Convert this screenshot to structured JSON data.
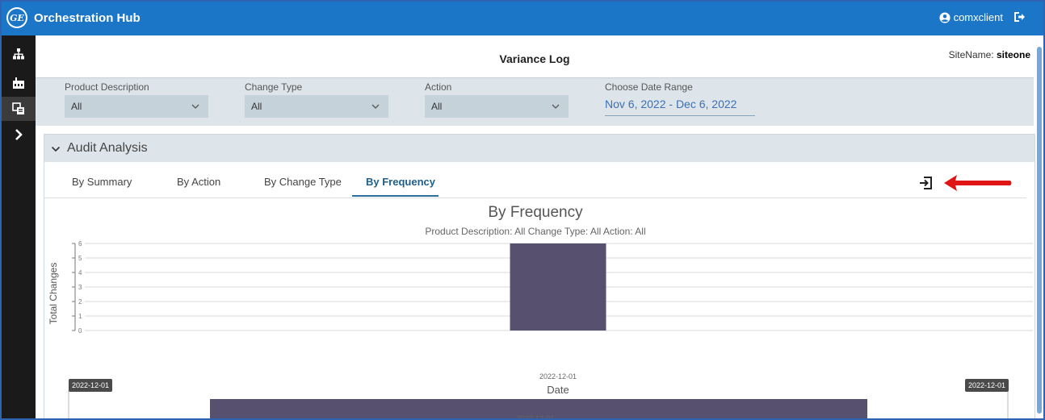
{
  "app": {
    "logo_text": "GE",
    "title": "Orchestration Hub",
    "user": "comxclient"
  },
  "page": {
    "title": "Variance Log",
    "sitename_label": "SiteName:",
    "sitename_value": "siteone"
  },
  "filters": {
    "product": {
      "label": "Product Description",
      "value": "All"
    },
    "change_type": {
      "label": "Change Type",
      "value": "All"
    },
    "action": {
      "label": "Action",
      "value": "All"
    },
    "date": {
      "label": "Choose Date Range",
      "value": "Nov 6, 2022 - Dec 6, 2022"
    }
  },
  "panel": {
    "title": "Audit Analysis",
    "tabs": [
      {
        "label": "By Summary",
        "active": false
      },
      {
        "label": "By Action",
        "active": false
      },
      {
        "label": "By Change Type",
        "active": false
      },
      {
        "label": "By Frequency",
        "active": true
      }
    ]
  },
  "icons": {
    "logo": "ge-logo",
    "user": "user-circle-icon",
    "logout": "logout-icon",
    "rail": [
      "sitemap-icon",
      "factory-icon",
      "clone-icon",
      "chevron-right-icon"
    ],
    "export": "export-icon",
    "collapse": "chevron-down-icon"
  },
  "colors": {
    "topbar": "#1b76c8",
    "bar": "#57506f",
    "accent_tab": "#1e5f8c",
    "date_text": "#3d6fb4",
    "arrow": "#e01515"
  },
  "chart_data": {
    "type": "bar",
    "title": "By Frequency",
    "subtitle": "Product Description: All   Change Type: All   Action: All",
    "categories": [
      "2022-12-01"
    ],
    "values": [
      6
    ],
    "xlabel": "Date",
    "ylabel": "Total Changes",
    "ylim": [
      0,
      6
    ],
    "yticks": [
      "0",
      "1",
      "2",
      "3",
      "4",
      "5",
      "6"
    ],
    "grid": true,
    "navigator": {
      "start_label": "2022-12-01",
      "end_label": "2022-12-01",
      "axis_label": "2022-12-01"
    }
  }
}
